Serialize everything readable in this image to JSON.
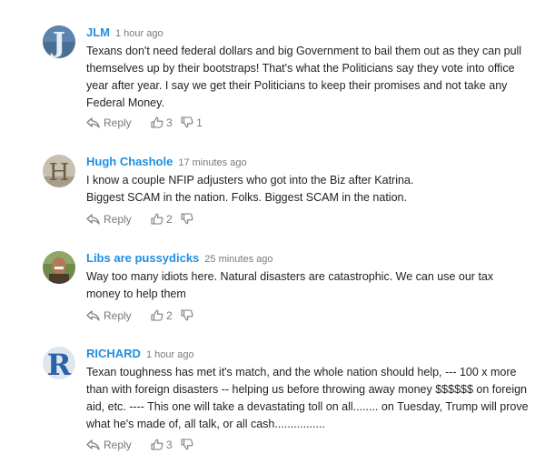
{
  "actions": {
    "reply_label": "Reply"
  },
  "colors": {
    "author": "#1f8fe0",
    "meta": "#7a7a7a",
    "text": "#222222"
  },
  "comments": [
    {
      "author": "JLM",
      "time": "1 hour ago",
      "avatar_letter": "J",
      "avatar_color": "#4a6f95",
      "body_lines": [
        "Texans don't need federal dollars and big Government to bail them out as they can pull",
        "themselves up by their bootstraps! That's what the Politicians say they vote into office",
        "year after year. I say we get their Politicians to keep their promises and not take any",
        "Federal Money."
      ],
      "upvotes": "3",
      "downvotes": "1"
    },
    {
      "author": "Hugh Chashole",
      "time": "17 minutes ago",
      "avatar_letter": "H",
      "avatar_color": "#c9bfae",
      "body_lines": [
        "I know a couple NFIP adjusters who got into the Biz after Katrina.",
        "Biggest SCAM in the nation. Folks. Biggest SCAM in the nation."
      ],
      "upvotes": "2",
      "downvotes": ""
    },
    {
      "author": "Libs are pussydicks",
      "time": "25 minutes ago",
      "avatar_letter": "",
      "avatar_color": "#6f8a4a",
      "body_lines": [
        "Way too many idiots here. Natural disasters are catastrophic. We can use our tax",
        "money to help them"
      ],
      "upvotes": "2",
      "downvotes": ""
    },
    {
      "author": "RICHARD",
      "time": "1 hour ago",
      "avatar_letter": "R",
      "avatar_color": "#dfe6ee",
      "body_lines": [
        "Texan toughness has met it's match, and the whole nation should help, --- 100 x more",
        "than with foreign disasters -- helping us before throwing away money $$$$$$ on foreign",
        "aid, etc. ---- This one will take a devastating toll on all........ on Tuesday, Trump will prove",
        "what he's made of, all talk, or all cash................"
      ],
      "upvotes": "3",
      "downvotes": ""
    }
  ]
}
